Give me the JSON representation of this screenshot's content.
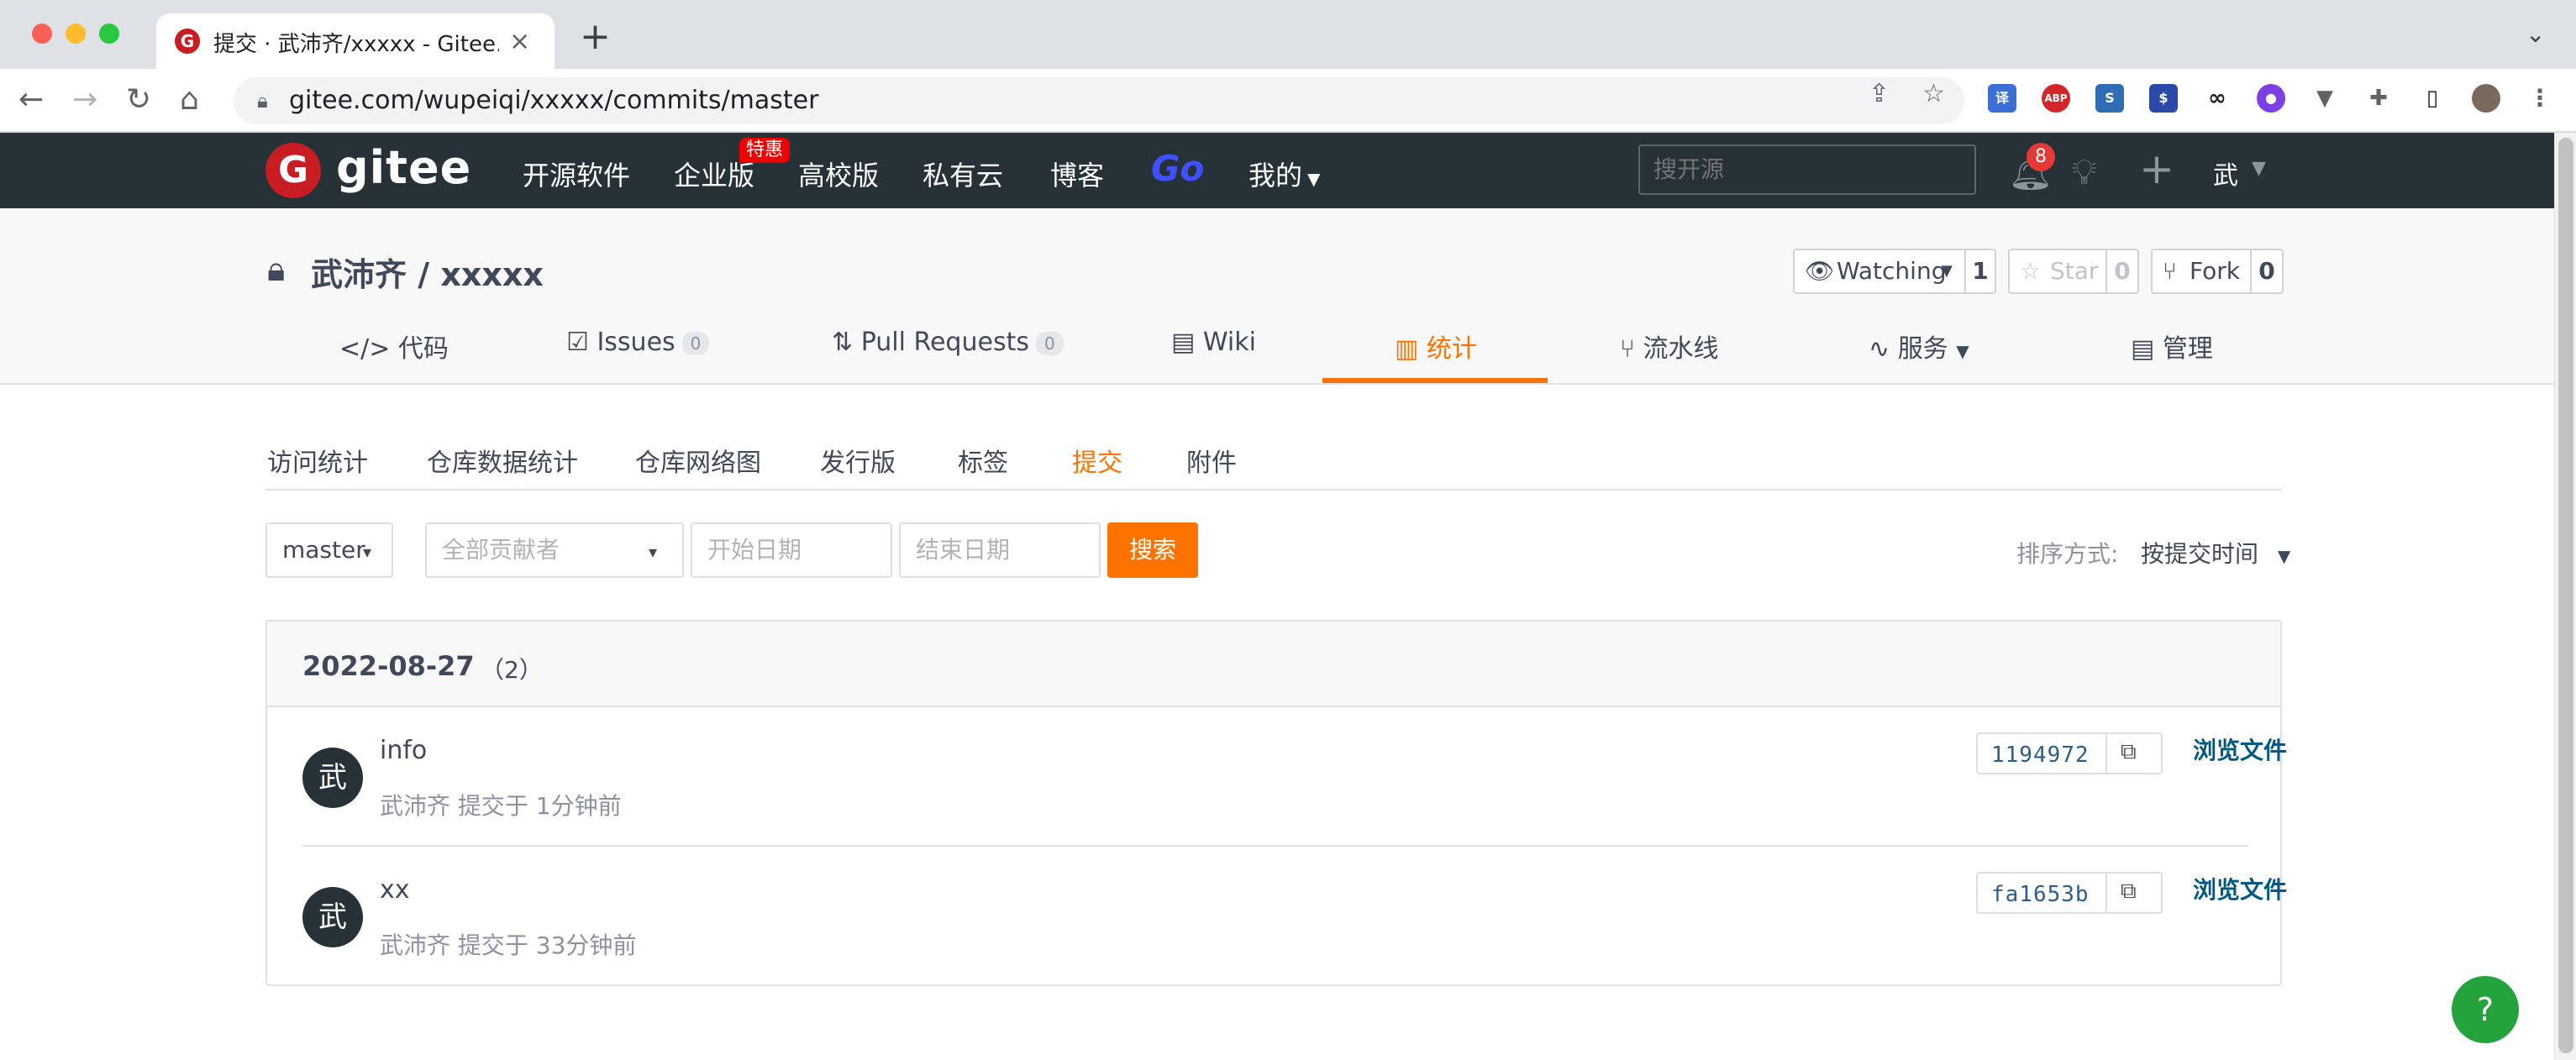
{
  "browser": {
    "tab_title": "提交 · 武沛齐/xxxxx - Gitee.com",
    "tab_close": "×",
    "new_tab": "+",
    "url": "gitee.com/wupeiqi/xxxxx/commits/master",
    "notification_count": "8"
  },
  "header": {
    "logo": "gitee",
    "nav": [
      "开源软件",
      "企业版",
      "高校版",
      "私有云",
      "博客"
    ],
    "promo_badge": "特惠",
    "go_link": "Go",
    "my_menu": "我的",
    "search_placeholder": "搜开源",
    "user_initial": "武"
  },
  "repo": {
    "title": "武沛齐 / xxxxx",
    "watching_label": "Watching",
    "watching_count": "1",
    "star_label": "Star",
    "star_count": "0",
    "fork_label": "Fork",
    "fork_count": "0",
    "tabs": {
      "code": "代码",
      "issues": "Issues",
      "issues_count": "0",
      "pulls": "Pull Requests",
      "pulls_count": "0",
      "wiki": "Wiki",
      "stats": "统计",
      "pipeline": "流水线",
      "services": "服务",
      "manage": "管理"
    }
  },
  "subnav": [
    "访问统计",
    "仓库数据统计",
    "仓库网络图",
    "发行版",
    "标签",
    "提交",
    "附件"
  ],
  "filters": {
    "branch": "master",
    "contributors_placeholder": "全部贡献者",
    "start_date_placeholder": "开始日期",
    "end_date_placeholder": "结束日期",
    "search_button": "搜索",
    "sort_label": "排序方式:",
    "sort_value": "按提交时间"
  },
  "commit_group": {
    "date": "2022-08-27",
    "count": "（2）",
    "commits": [
      {
        "avatar": "武",
        "message": "info",
        "meta": "武沛齐 提交于 1分钟前",
        "sha": "1194972",
        "browse": "浏览文件"
      },
      {
        "avatar": "武",
        "message": "xx",
        "meta": "武沛齐 提交于 33分钟前",
        "sha": "fa1653b",
        "browse": "浏览文件"
      }
    ]
  },
  "help_label": "?",
  "colors": {
    "accent": "#fe7300",
    "header_bg": "#263238",
    "brand": "#c71d23",
    "help": "#24a23c"
  }
}
